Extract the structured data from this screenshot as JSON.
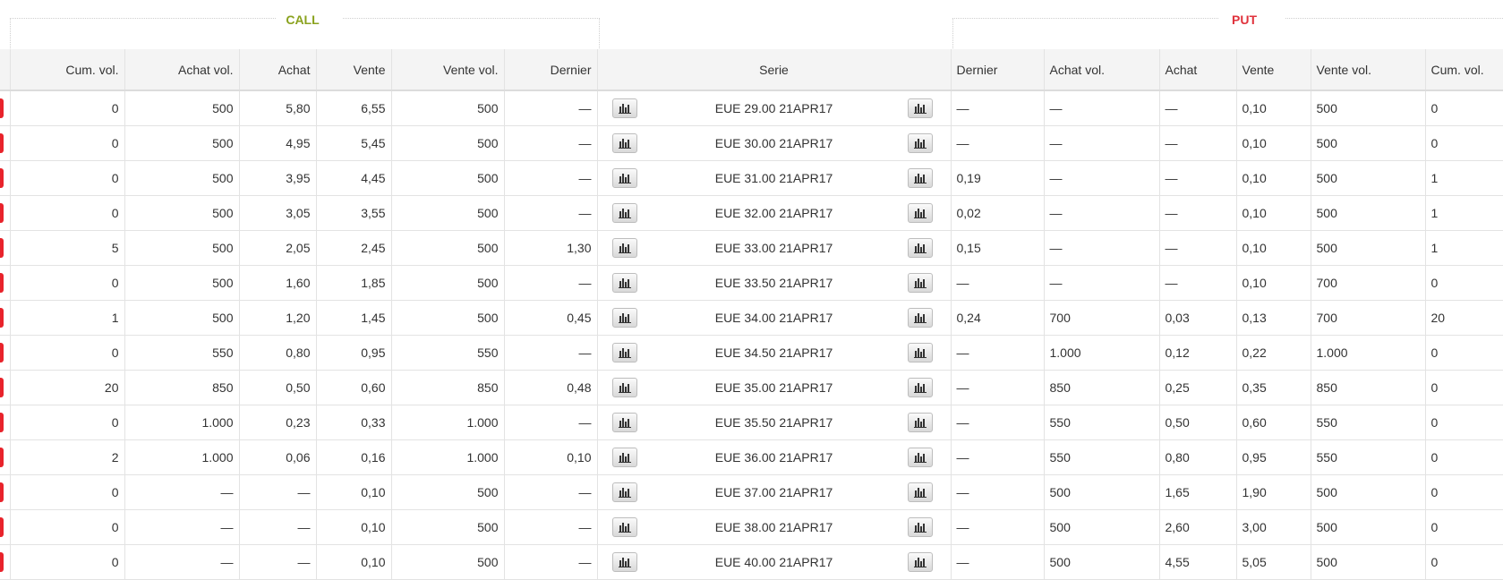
{
  "groups": {
    "call": "CALL",
    "put": "PUT"
  },
  "headers": {
    "call": [
      "Cum. vol.",
      "Achat vol.",
      "Achat",
      "Vente",
      "Vente vol.",
      "Dernier"
    ],
    "serie": "Serie",
    "put": [
      "Dernier",
      "Achat vol.",
      "Achat",
      "Vente",
      "Vente vol.",
      "Cum. vol."
    ]
  },
  "icons": {
    "chart_button": "bar-chart-icon"
  },
  "colors": {
    "call": "#8aa21e",
    "put": "#e0323c",
    "row_marker": "#e8232b"
  },
  "rows": [
    {
      "call": [
        "0",
        "500",
        "5,80",
        "6,55",
        "500",
        "—"
      ],
      "serie": "EUE 29.00 21APR17",
      "put": [
        "—",
        "—",
        "—",
        "0,10",
        "500",
        "0"
      ]
    },
    {
      "call": [
        "0",
        "500",
        "4,95",
        "5,45",
        "500",
        "—"
      ],
      "serie": "EUE 30.00 21APR17",
      "put": [
        "—",
        "—",
        "—",
        "0,10",
        "500",
        "0"
      ]
    },
    {
      "call": [
        "0",
        "500",
        "3,95",
        "4,45",
        "500",
        "—"
      ],
      "serie": "EUE 31.00 21APR17",
      "put": [
        "0,19",
        "—",
        "—",
        "0,10",
        "500",
        "1"
      ]
    },
    {
      "call": [
        "0",
        "500",
        "3,05",
        "3,55",
        "500",
        "—"
      ],
      "serie": "EUE 32.00 21APR17",
      "put": [
        "0,02",
        "—",
        "—",
        "0,10",
        "500",
        "1"
      ]
    },
    {
      "call": [
        "5",
        "500",
        "2,05",
        "2,45",
        "500",
        "1,30"
      ],
      "serie": "EUE 33.00 21APR17",
      "put": [
        "0,15",
        "—",
        "—",
        "0,10",
        "500",
        "1"
      ]
    },
    {
      "call": [
        "0",
        "500",
        "1,60",
        "1,85",
        "500",
        "—"
      ],
      "serie": "EUE 33.50 21APR17",
      "put": [
        "—",
        "—",
        "—",
        "0,10",
        "700",
        "0"
      ]
    },
    {
      "call": [
        "1",
        "500",
        "1,20",
        "1,45",
        "500",
        "0,45"
      ],
      "serie": "EUE 34.00 21APR17",
      "put": [
        "0,24",
        "700",
        "0,03",
        "0,13",
        "700",
        "20"
      ]
    },
    {
      "call": [
        "0",
        "550",
        "0,80",
        "0,95",
        "550",
        "—"
      ],
      "serie": "EUE 34.50 21APR17",
      "put": [
        "—",
        "1.000",
        "0,12",
        "0,22",
        "1.000",
        "0"
      ]
    },
    {
      "call": [
        "20",
        "850",
        "0,50",
        "0,60",
        "850",
        "0,48"
      ],
      "serie": "EUE 35.00 21APR17",
      "put": [
        "—",
        "850",
        "0,25",
        "0,35",
        "850",
        "0"
      ]
    },
    {
      "call": [
        "0",
        "1.000",
        "0,23",
        "0,33",
        "1.000",
        "—"
      ],
      "serie": "EUE 35.50 21APR17",
      "put": [
        "—",
        "550",
        "0,50",
        "0,60",
        "550",
        "0"
      ]
    },
    {
      "call": [
        "2",
        "1.000",
        "0,06",
        "0,16",
        "1.000",
        "0,10"
      ],
      "serie": "EUE 36.00 21APR17",
      "put": [
        "—",
        "550",
        "0,80",
        "0,95",
        "550",
        "0"
      ]
    },
    {
      "call": [
        "0",
        "—",
        "—",
        "0,10",
        "500",
        "—"
      ],
      "serie": "EUE 37.00 21APR17",
      "put": [
        "—",
        "500",
        "1,65",
        "1,90",
        "500",
        "0"
      ]
    },
    {
      "call": [
        "0",
        "—",
        "—",
        "0,10",
        "500",
        "—"
      ],
      "serie": "EUE 38.00 21APR17",
      "put": [
        "—",
        "500",
        "2,60",
        "3,00",
        "500",
        "0"
      ]
    },
    {
      "call": [
        "0",
        "—",
        "—",
        "0,10",
        "500",
        "—"
      ],
      "serie": "EUE 40.00 21APR17",
      "put": [
        "—",
        "500",
        "4,55",
        "5,05",
        "500",
        "0"
      ]
    }
  ]
}
